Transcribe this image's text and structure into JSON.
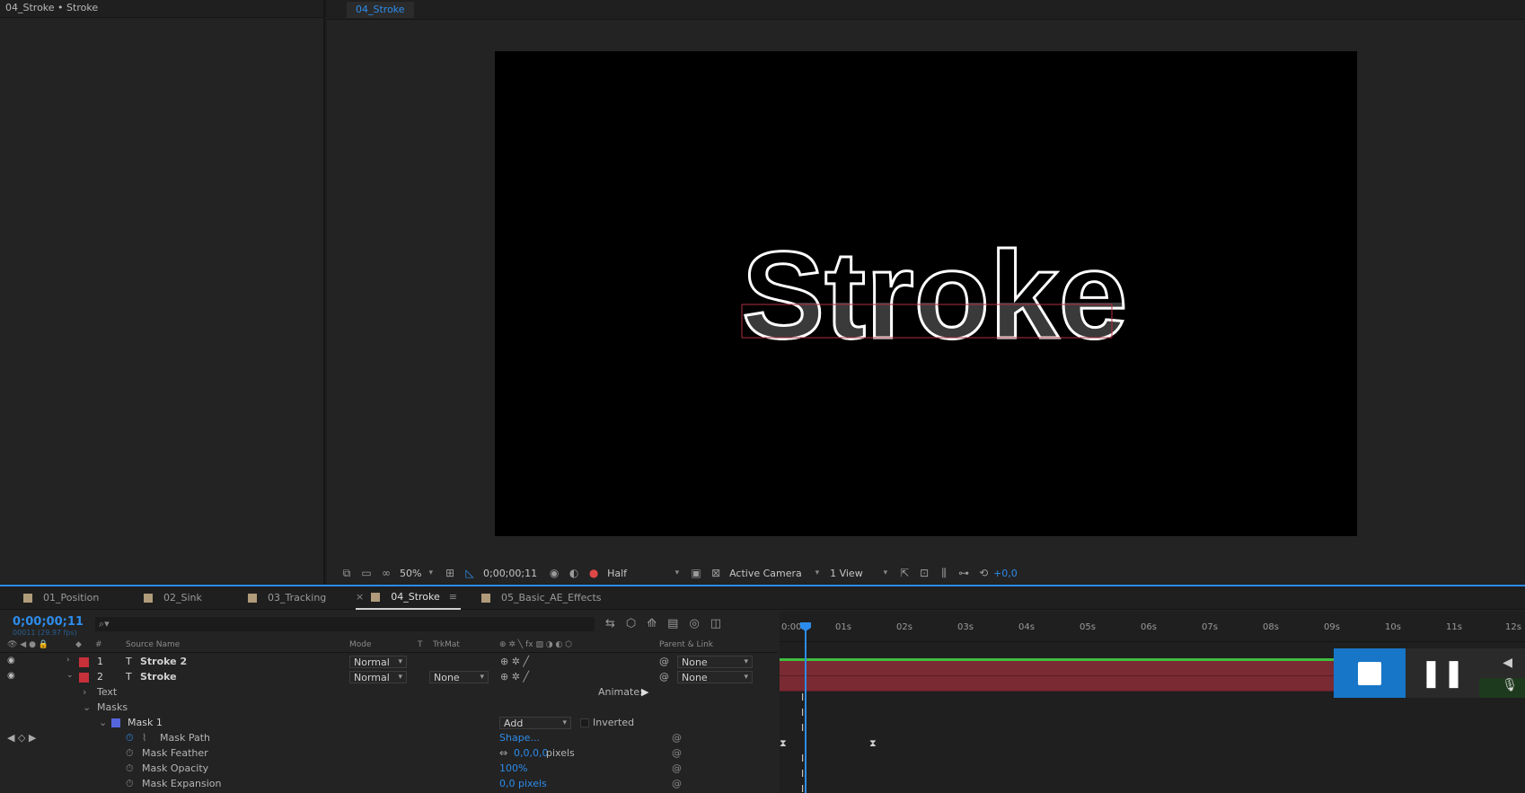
{
  "project_panel": {
    "title": "04_Stroke • Stroke"
  },
  "comp_viewer": {
    "tab": "04_Stroke",
    "stage_text": "Stroke",
    "toolbar": {
      "zoom": "50%",
      "timecode": "0;00;00;11",
      "resolution": "Half",
      "camera": "Active Camera",
      "views": "1 View",
      "exposure": "+0,0"
    }
  },
  "timeline": {
    "tabs": [
      "01_Position",
      "02_Sink",
      "03_Tracking",
      "04_Stroke",
      "05_Basic_AE_Effects"
    ],
    "active_tab": "04_Stroke",
    "timecode": "0;00;00;11",
    "timecode_sub": "00011 (29.97 fps)",
    "search_placeholder": "⌕▾",
    "columns": {
      "num": "#",
      "source_name": "Source Name",
      "mode": "Mode",
      "t": "T",
      "trkmat": "TrkMat",
      "parent": "Parent & Link"
    },
    "layers": [
      {
        "num": "1",
        "type": "T",
        "name": "Stroke 2",
        "mode": "Normal",
        "trkmat": "",
        "parent": "None"
      },
      {
        "num": "2",
        "type": "T",
        "name": "Stroke",
        "mode": "Normal",
        "trkmat": "None",
        "parent": "None"
      }
    ],
    "props": {
      "text": "Text",
      "animate_label": "Animate:",
      "masks": "Masks",
      "mask1": "Mask 1",
      "mask1_mode": "Add",
      "inverted": "Inverted",
      "mask_path": "Mask Path",
      "mask_path_val": "Shape...",
      "mask_feather": "Mask Feather",
      "mask_feather_val": "0,0,0,0",
      "mask_feather_unit": "pixels",
      "mask_opacity": "Mask Opacity",
      "mask_opacity_val": "100%",
      "mask_expansion": "Mask Expansion",
      "mask_expansion_val": "0,0 pixels"
    },
    "ruler": [
      "0:00s",
      "01s",
      "02s",
      "03s",
      "04s",
      "05s",
      "06s",
      "07s",
      "08s",
      "09s",
      "10s",
      "11s",
      "12s"
    ]
  },
  "colors": {
    "accent": "#2d8ceb",
    "layer_label": "#c8303a",
    "layer_bar": "#7a2a33",
    "work_area": "#3fbf3f"
  }
}
